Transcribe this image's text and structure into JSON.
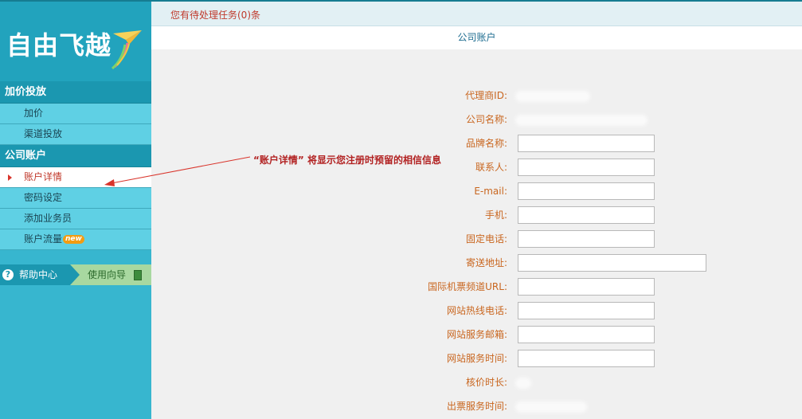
{
  "logo": {
    "text": "自由飞越"
  },
  "topbar": {
    "pending_tasks": "您有待处理任务(0)条"
  },
  "page": {
    "title": "公司账户"
  },
  "sidebar": {
    "sections": [
      {
        "title": "加价投放",
        "items": [
          "加价",
          "渠道投放"
        ]
      },
      {
        "title": "公司账户",
        "items": [
          "账户详情",
          "密码设定",
          "添加业务员",
          "账户流量"
        ]
      }
    ],
    "new_badge": "new",
    "help_center": "帮助中心",
    "help_icon": "?",
    "guide": "使用向导"
  },
  "annotation": {
    "text": "“账户详情” 将显示您注册时预留的相信信息"
  },
  "form": {
    "fields": [
      {
        "label": "代理商ID:",
        "type": "text",
        "value": ""
      },
      {
        "label": "公司名称:",
        "type": "text",
        "value": ""
      },
      {
        "label": "品牌名称:",
        "type": "input",
        "value": ""
      },
      {
        "label": "联系人:",
        "type": "input",
        "value": ""
      },
      {
        "label": "E-mail:",
        "type": "input",
        "value": ""
      },
      {
        "label": "手机:",
        "type": "input",
        "value": ""
      },
      {
        "label": "固定电话:",
        "type": "input",
        "value": ""
      },
      {
        "label": "寄送地址:",
        "type": "input-wide",
        "value": ""
      },
      {
        "label": "国际机票频道URL:",
        "type": "input",
        "value": ""
      },
      {
        "label": "网站热线电话:",
        "type": "input",
        "value": ""
      },
      {
        "label": "网站服务邮箱:",
        "type": "input",
        "value": ""
      },
      {
        "label": "网站服务时间:",
        "type": "input",
        "value": ""
      },
      {
        "label": "核价时长:",
        "type": "text",
        "value": ""
      },
      {
        "label": "出票服务时间:",
        "type": "text",
        "value": ""
      }
    ]
  },
  "colors": {
    "sidebar": "#37b6cf",
    "section": "#1b97b0",
    "menu": "#5fd0e4",
    "label": "#c9661f",
    "alert": "#c0392b"
  }
}
